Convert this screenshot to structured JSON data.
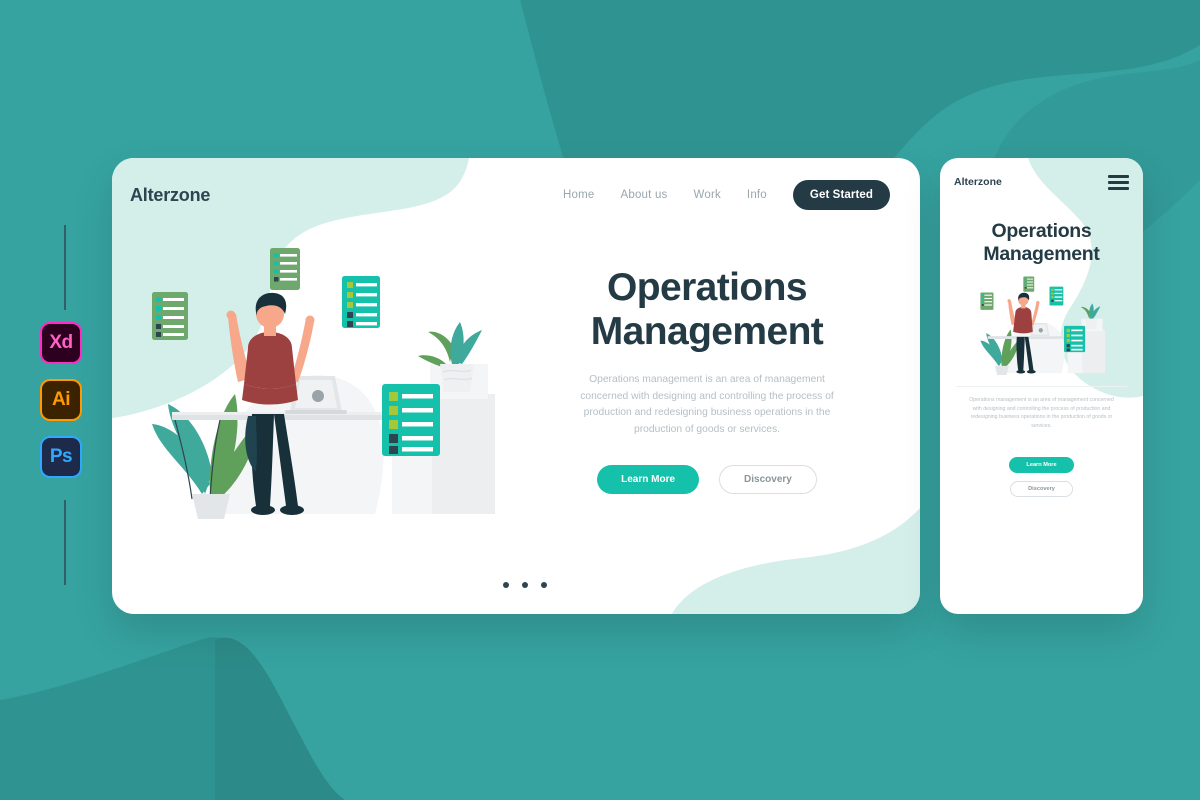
{
  "theme": {
    "background": "#36a3a0",
    "background_blob": "#2f9491",
    "card_blob_mint": "#d4eeea",
    "accent_teal": "#16c1ab",
    "dark_slate": "#243b45",
    "muted_text": "#b6bfc4"
  },
  "tool_rail": {
    "icons": [
      {
        "name": "adobe-xd-icon",
        "label": "Xd",
        "fill": "#2e001f",
        "accent": "#ff61c7"
      },
      {
        "name": "adobe-illustrator-icon",
        "label": "Ai",
        "fill": "#3b2300",
        "accent": "#ff9a00"
      },
      {
        "name": "adobe-photoshop-icon",
        "label": "Ps",
        "fill": "#1e2a4a",
        "accent": "#31a8ff"
      }
    ]
  },
  "desktop": {
    "logo": "Alterzone",
    "nav": [
      {
        "label": "Home"
      },
      {
        "label": "About us"
      },
      {
        "label": "Work"
      },
      {
        "label": "Info"
      }
    ],
    "cta_nav": "Get Started",
    "headline_line1": "Operations",
    "headline_line2": "Management",
    "paragraph": "Operations management is an area of management concerned with designing and controlling the process of production and redesigning business operations in the production of goods or services.",
    "buttons": {
      "primary": "Learn More",
      "secondary": "Discovery"
    },
    "carousel_dots": 3
  },
  "mobile": {
    "logo": "Alterzone",
    "menu_icon": "hamburger-menu-icon",
    "headline_line1": "Operations",
    "headline_line2": "Management",
    "paragraph": "Operations management is an area of management concerned with designing and controlling the process of production and redesigning business operations in the production of goods or services.",
    "buttons": {
      "primary": "Learn More",
      "secondary": "Discovery"
    }
  },
  "illustration": {
    "name": "person-at-standing-desk-with-checklists",
    "elements": [
      "person-arms-raised",
      "standing-desk",
      "laptop",
      "monstera-plant",
      "potted-plant-on-pedestal",
      "checklist-card-green-left",
      "checklist-card-green-top",
      "checklist-card-teal-upper",
      "checklist-card-teal-large"
    ],
    "palette": {
      "skin": "#f7a78a",
      "shirt": "#9d4040",
      "pants": "#17303a",
      "hair": "#17303a",
      "desk": "#e3e6e8",
      "card_teal": "#16c1ab",
      "card_green": "#6fa86c",
      "check_lime": "#a5c73a",
      "check_dark": "#2d4550",
      "leaf_teal": "#3fa99b",
      "leaf_green": "#5fa05a"
    }
  }
}
